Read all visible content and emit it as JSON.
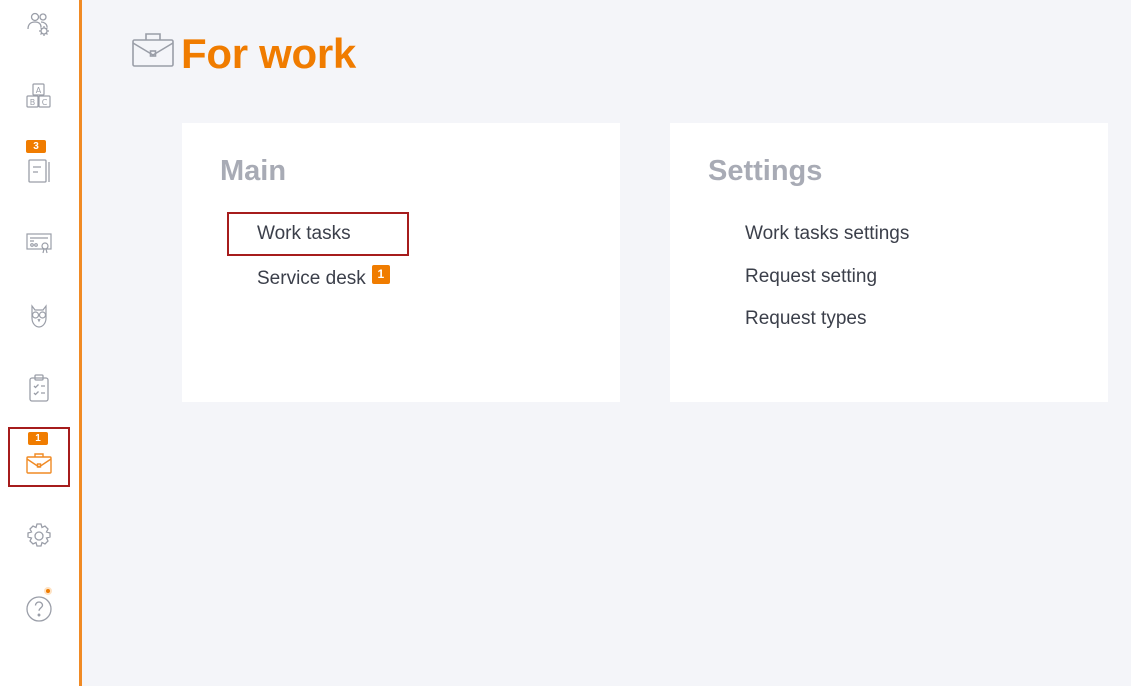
{
  "sidebar": {
    "items": [
      {
        "name": "users-settings",
        "badge": ""
      },
      {
        "name": "abc-dictionary",
        "badge": ""
      },
      {
        "name": "journal",
        "badge": "3"
      },
      {
        "name": "certificates",
        "badge": ""
      },
      {
        "name": "owl-mascot",
        "badge": ""
      },
      {
        "name": "checklist-clipboard",
        "badge": ""
      },
      {
        "name": "for-work-briefcase",
        "badge": "1",
        "active": true
      },
      {
        "name": "settings-gear",
        "badge": ""
      },
      {
        "name": "help-question",
        "badge": ""
      }
    ],
    "accent": "#f08a24"
  },
  "page": {
    "title": "For work",
    "icon": "briefcase-icon"
  },
  "main_card": {
    "heading": "Main",
    "links": [
      {
        "label": "Work tasks",
        "badge": ""
      },
      {
        "label": "Service desk",
        "badge": "1"
      }
    ]
  },
  "settings_card": {
    "heading": "Settings",
    "links": [
      {
        "label": "Work tasks settings"
      },
      {
        "label": "Request setting"
      },
      {
        "label": "Request types"
      }
    ]
  },
  "colors": {
    "accent": "#f07c00",
    "highlight": "#a61c1c",
    "heading_gray": "#a8abb5",
    "background": "#f4f5f9"
  }
}
